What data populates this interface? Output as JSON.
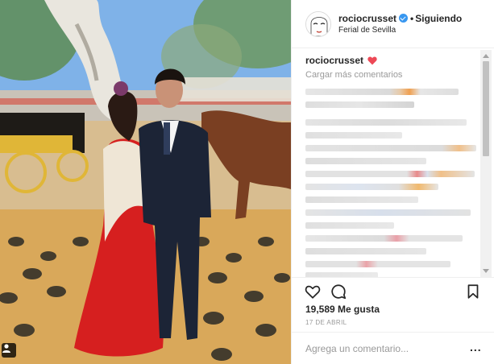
{
  "photo": {
    "tag_icon": "user-tag-icon"
  },
  "header": {
    "avatar_icon": "profile-avatar-icon",
    "username": "rociocrusset",
    "verified_icon": "verified-badge-icon",
    "separator": "•",
    "follow_status": "Siguiendo",
    "location": "Ferial de Sevilla"
  },
  "caption": {
    "username": "rociocrusset",
    "emoji": "red-heart-icon"
  },
  "comments": {
    "load_more": "Cargar más comentarios"
  },
  "actions": {
    "like_icon": "heart-outline-icon",
    "comment_icon": "comment-bubble-icon",
    "save_icon": "bookmark-icon"
  },
  "likes": "19,589 Me gusta",
  "date": "17 DE ABRIL",
  "comment_box": {
    "placeholder": "Agrega un comentario...",
    "more": "..."
  },
  "colors": {
    "accent_blue": "#3897f0",
    "heart_red": "#ed4956",
    "muted_text": "#999999",
    "border": "#efefef"
  }
}
